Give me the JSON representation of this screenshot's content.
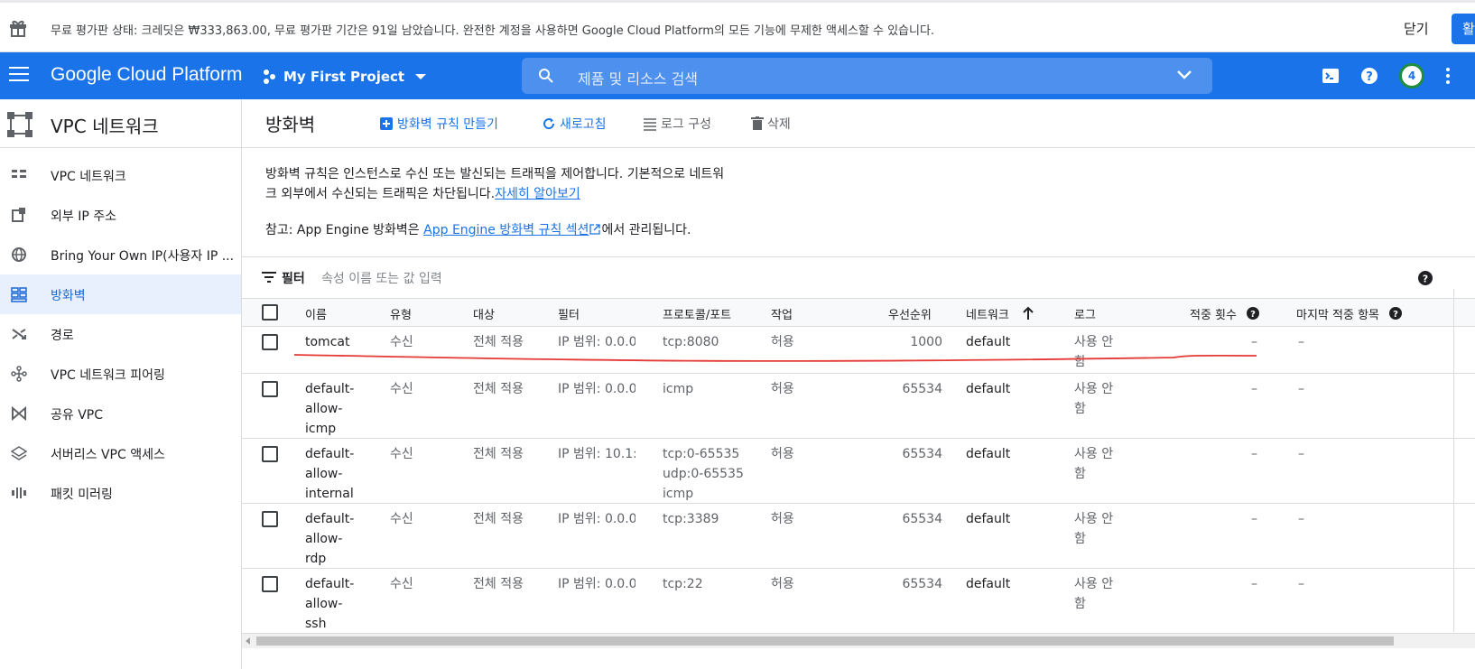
{
  "banner": {
    "message": "무료 평가판 상태: 크레딧은 ₩333,863.00, 무료 평가판 기간은 91일 남았습니다. 완전한 계정을 사용하면 Google Cloud Platform의 모든 기능에 무제한 액세스할 수 있습니다.",
    "close_label": "닫기",
    "activate_label": "활",
    "gift_icon": "gift-icon"
  },
  "topbar": {
    "brand": "Google Cloud Platform",
    "project": "My First Project",
    "search_placeholder": "제품 및 리소스 검색",
    "notification_count": "4",
    "accent": "#1a73e8"
  },
  "sidebar": {
    "title": "VPC 네트워크",
    "items": [
      {
        "label": "VPC 네트워크",
        "icon": "vpc-network-icon"
      },
      {
        "label": "외부 IP 주소",
        "icon": "external-ip-icon"
      },
      {
        "label": "Bring Your Own IP(사용자 IP ...",
        "icon": "globe-icon"
      },
      {
        "label": "방화벽",
        "icon": "firewall-icon"
      },
      {
        "label": "경로",
        "icon": "routes-icon"
      },
      {
        "label": "VPC 네트워크 피어링",
        "icon": "peering-icon"
      },
      {
        "label": "공유 VPC",
        "icon": "shared-vpc-icon"
      },
      {
        "label": "서버리스 VPC 액세스",
        "icon": "serverless-icon"
      },
      {
        "label": "패킷 미러링",
        "icon": "mirroring-icon"
      }
    ],
    "active_index": 3
  },
  "main": {
    "title": "방화벽",
    "actions": {
      "create": "방화벽 규칙 만들기",
      "refresh": "새로고침",
      "logs": "로그 구성",
      "delete": "삭제"
    },
    "description_1": "방화벽 규칙은 인스턴스로 수신 또는 발신되는 트래픽을 제어합니다. 기본적으로 네트워",
    "description_2": "크 외부에서 수신되는 트래픽은 차단됩니다.",
    "learn_more": "자세히 알아보기",
    "note_prefix": "참고: App Engine 방화벽은 ",
    "note_link": "App Engine 방화벽 규칙 섹션",
    "note_suffix": "에서 관리됩니다.",
    "filter_label": "필터",
    "filter_placeholder": "속성 이름 또는 값 입력"
  },
  "table": {
    "headers": {
      "name": "이름",
      "type": "유형",
      "target": "대상",
      "filter": "필터",
      "protocol": "프로토콜/포트",
      "action": "작업",
      "priority": "우선순위",
      "network": "네트워크",
      "logs": "로그",
      "hits": "적중 횟수",
      "last_hit": "마지막 적중 항목"
    },
    "rows": [
      {
        "name": "tomcat",
        "type": "수신",
        "target": "전체 적용",
        "filter": "IP 범위: 0.0.0",
        "protocol": "tcp:8080",
        "action": "허용",
        "priority": "1000",
        "network": "default",
        "logs": "사용 안\n함",
        "hits": "–",
        "last_hit": "–"
      },
      {
        "name": "default-\nallow-\nicmp",
        "type": "수신",
        "target": "전체 적용",
        "filter": "IP 범위: 0.0.0",
        "protocol": "icmp",
        "action": "허용",
        "priority": "65534",
        "network": "default",
        "logs": "사용 안\n함",
        "hits": "–",
        "last_hit": "–"
      },
      {
        "name": "default-\nallow-\ninternal",
        "type": "수신",
        "target": "전체 적용",
        "filter": "IP 범위: 10.1:",
        "protocol": "tcp:0-65535\nudp:0-65535\nicmp",
        "action": "허용",
        "priority": "65534",
        "network": "default",
        "logs": "사용 안\n함",
        "hits": "–",
        "last_hit": "–"
      },
      {
        "name": "default-\nallow-\nrdp",
        "type": "수신",
        "target": "전체 적용",
        "filter": "IP 범위: 0.0.0",
        "protocol": "tcp:3389",
        "action": "허용",
        "priority": "65534",
        "network": "default",
        "logs": "사용 안\n함",
        "hits": "–",
        "last_hit": "–"
      },
      {
        "name": "default-\nallow-\nssh",
        "type": "수신",
        "target": "전체 적용",
        "filter": "IP 범위: 0.0.0",
        "protocol": "tcp:22",
        "action": "허용",
        "priority": "65534",
        "network": "default",
        "logs": "사용 안\n함",
        "hits": "–",
        "last_hit": "–"
      }
    ]
  },
  "annotation_color": "#e53935"
}
